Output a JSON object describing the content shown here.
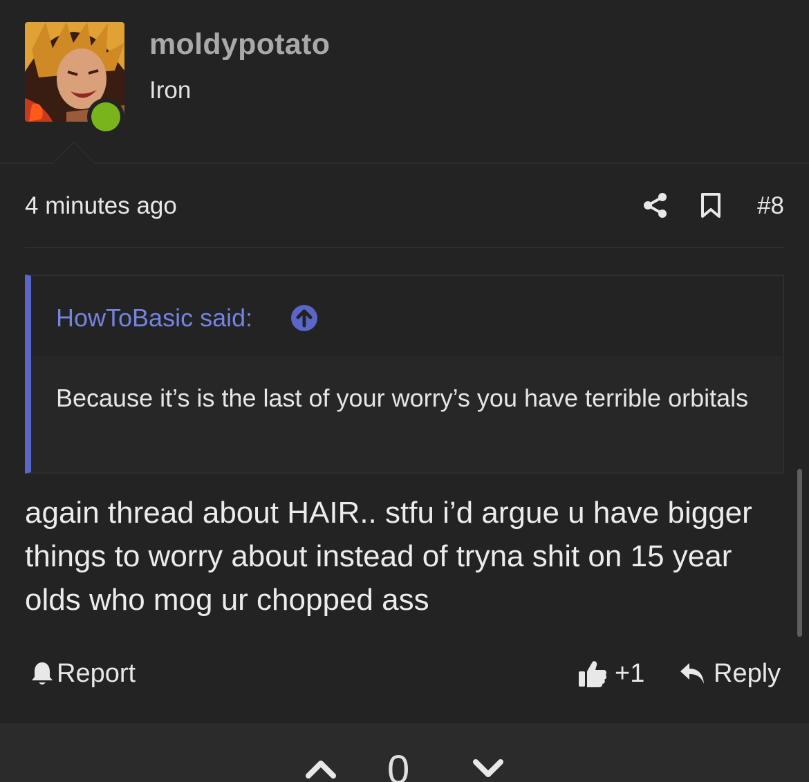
{
  "author": {
    "username": "moldypotato",
    "title": "Iron",
    "avatar_icon": "anime-character-avatar",
    "online_color": "#7ab41d"
  },
  "post": {
    "time": "4 minutes ago",
    "number": "#8",
    "share_icon": "share-icon",
    "bookmark_icon": "bookmark-icon"
  },
  "quote": {
    "author_label": "HowToBasic said:",
    "body": "Because it’s is the last of your worry’s you have terrible orbitals",
    "accent_color": "#5a67c9"
  },
  "message": {
    "text": "again thread about HAIR.. stfu i’d argue u have bigger things to worry about instead of tryna shit on 15 year olds who mog ur chopped ass"
  },
  "actions": {
    "report_label": "Report",
    "like_count": "+1",
    "reply_label": "Reply"
  },
  "votes": {
    "count": "0"
  }
}
